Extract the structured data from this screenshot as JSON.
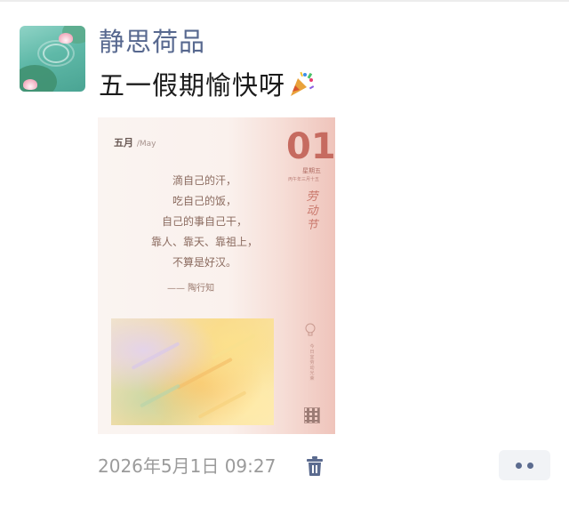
{
  "post": {
    "nickname": "静思荷品",
    "text": "五一假期愉快呀",
    "emoji": "party-popper-icon",
    "timestamp": "2026年5月1日 09:27"
  },
  "photo": {
    "month": "五月",
    "month_en": "/May",
    "day": "01",
    "weekday": "星期五",
    "lunar": "丙午年三月十五",
    "festival": "劳动节",
    "poem": [
      "滴自己的汗，",
      "吃自己的饭，",
      "自己的事自己干，",
      "靠人、靠天、靠祖上，",
      "不算是好汉。"
    ],
    "author": "—— 陶行知",
    "side_note": "今日宜劳动光荣"
  },
  "colors": {
    "nickname": "#57688f",
    "accent_red": "#c66b60",
    "more_dots": "#5b6b8f"
  }
}
